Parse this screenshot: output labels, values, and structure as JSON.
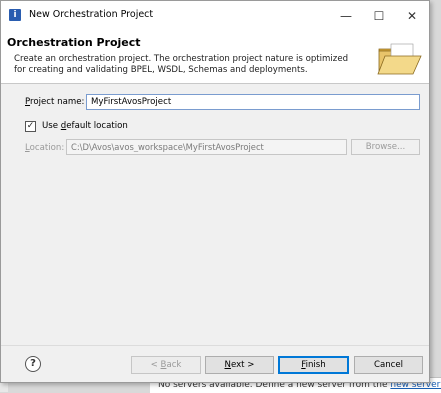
{
  "background": {
    "status_text": "No servers available. Define a new server from the",
    "status_link": "new server wizard..."
  },
  "window": {
    "title": "New Orchestration Project",
    "minimize_glyph": "—",
    "maximize_glyph": "☐",
    "close_glyph": "✕"
  },
  "header": {
    "title": "Orchestration Project",
    "description": "Create an orchestration project.  The orchestration project nature is optimized for creating and validating BPEL, WSDL, Schemas and deployments."
  },
  "form": {
    "project_name_label_mnemonic": "P",
    "project_name_label_rest": "roject name:",
    "project_name_value": "MyFirstAvosProject",
    "use_default_checked": true,
    "use_default_prefix": "Use ",
    "use_default_mnemonic": "d",
    "use_default_rest": "efault location",
    "location_label_mnemonic": "L",
    "location_label_rest": "ocation:",
    "location_value": "C:\\D\\Avos\\avos_workspace\\MyFirstAvosProject",
    "browse_label": "Browse..."
  },
  "footer": {
    "help_glyph": "?",
    "back_prefix": "< ",
    "back_mnemonic": "B",
    "back_rest": "ack",
    "next_mnemonic": "N",
    "next_rest": "ext >",
    "finish_mnemonic": "F",
    "finish_rest": "inish",
    "cancel_label": "Cancel"
  },
  "colors": {
    "accent": "#0078d7",
    "title_icon": "#2a5db0",
    "folder": "#e8c46a"
  }
}
